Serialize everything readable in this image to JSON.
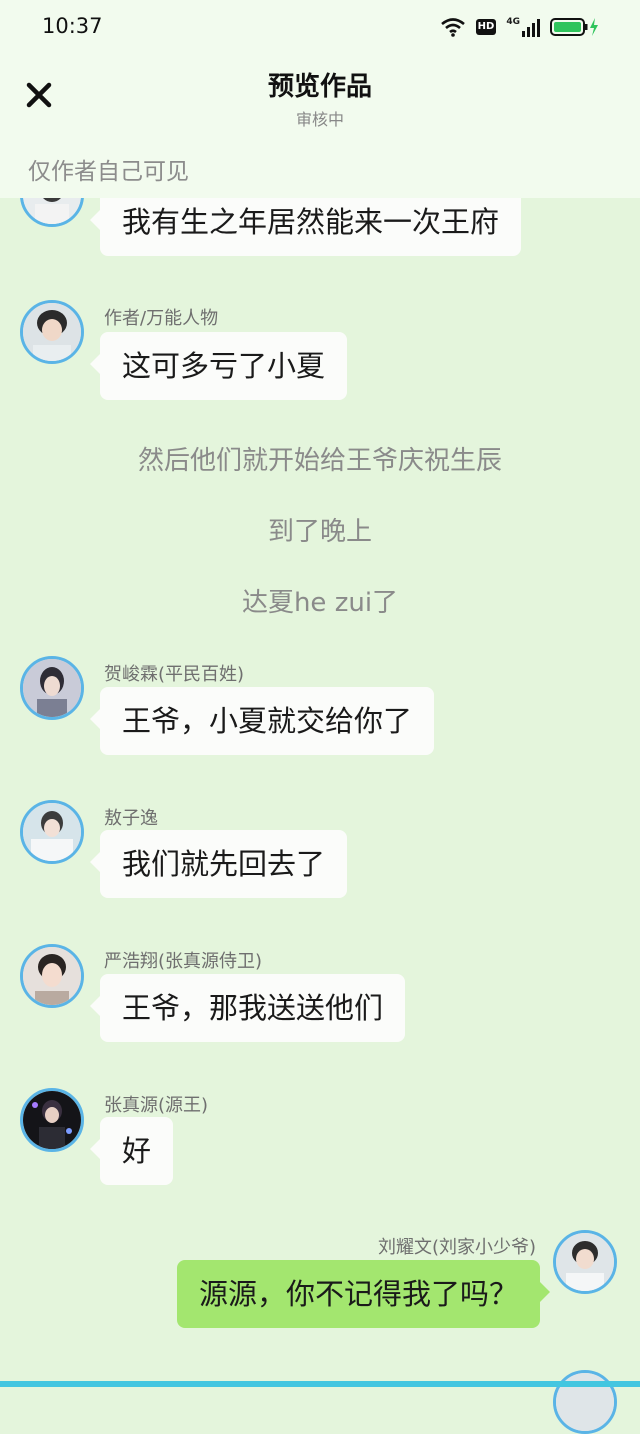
{
  "status_bar": {
    "time": "10:37",
    "hd_label": "HD",
    "network_label": "4G"
  },
  "header": {
    "title": "预览作品",
    "subtitle": "审核中",
    "visibility_note": "仅作者自己可见"
  },
  "messages": [
    {
      "name": "",
      "text": "我有生之年居然能来一次王府"
    },
    {
      "name": "作者/万能人物",
      "text": "这可多亏了小夏"
    },
    {
      "name": "贺峻霖(平民百姓)",
      "text": "王爷，小夏就交给你了"
    },
    {
      "name": "敖子逸",
      "text": "我们就先回去了"
    },
    {
      "name": "严浩翔(张真源侍卫)",
      "text": "王爷，那我送送他们"
    },
    {
      "name": "张真源(源王)",
      "text": "好"
    },
    {
      "name": "刘耀文(刘家小少爷)",
      "text": "源源，你不记得我了吗？"
    }
  ],
  "narrations": [
    "然后他们就开始给王爷庆祝生辰",
    "到了晚上",
    "达夏he zui了"
  ],
  "colors": {
    "background": "#e4f5dc",
    "right_bubble": "#a3e66f",
    "avatar_ring": "#5ab4e6"
  }
}
